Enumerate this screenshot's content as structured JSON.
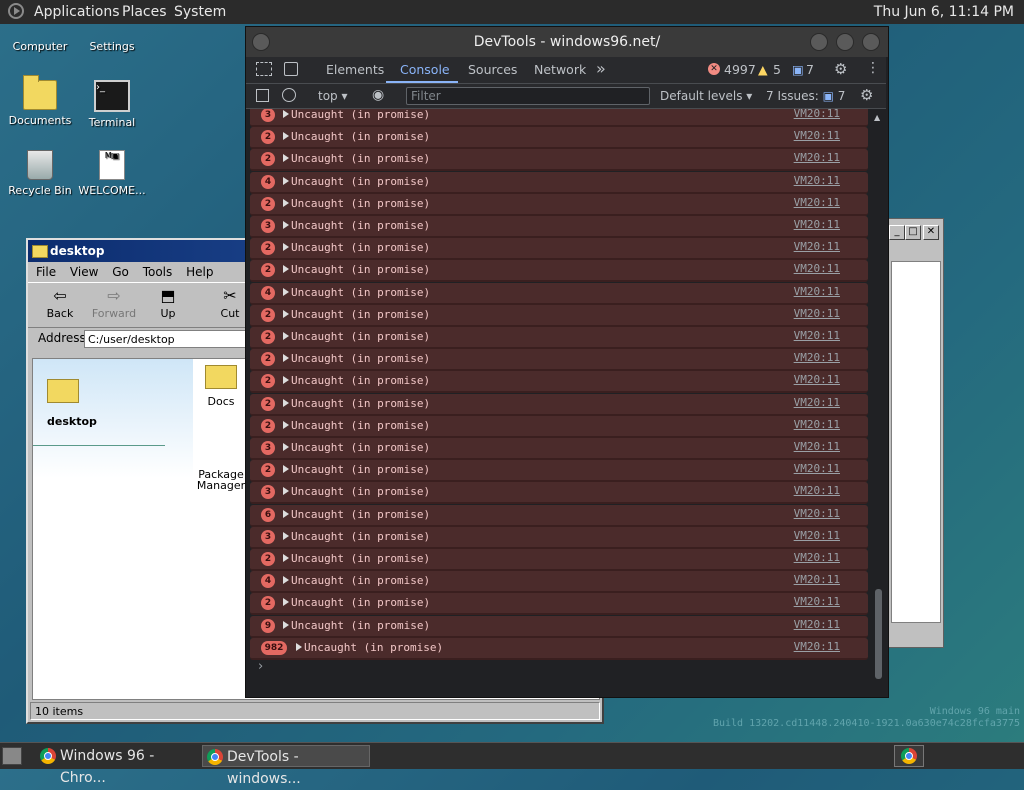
{
  "top_panel": {
    "applications": "Applications",
    "places": "Places",
    "system": "System",
    "clock": "Thu Jun  6, 11:14 PM"
  },
  "desktop_icons": [
    {
      "label": "Computer"
    },
    {
      "label": "Settings"
    },
    {
      "label": "Documents"
    },
    {
      "label": "Terminal"
    },
    {
      "label": "Recycle Bin"
    },
    {
      "label": "WELCOME..."
    }
  ],
  "explorer": {
    "title": "desktop",
    "menu": [
      "File",
      "View",
      "Go",
      "Tools",
      "Help"
    ],
    "toolbar": [
      {
        "label": "Back",
        "glyph": "⇦"
      },
      {
        "label": "Forward",
        "glyph": "⇨"
      },
      {
        "label": "Up",
        "glyph": "⬒"
      },
      {
        "label": "Cut",
        "glyph": "✂"
      }
    ],
    "address_label": "Address",
    "address_value": "C:/user/desktop",
    "sidepane_title": "desktop",
    "items": [
      {
        "label": "Docs"
      },
      {
        "label": "Package Manager"
      }
    ],
    "status": "10 items"
  },
  "devtools": {
    "title": "DevTools - windows96.net/",
    "tabs": [
      "Elements",
      "Console",
      "Sources",
      "Network"
    ],
    "more_tabs": "»",
    "error_count": "4997",
    "warning_count": "5",
    "info_count": "7",
    "context": "top",
    "filter_placeholder": "Filter",
    "levels": "Default levels",
    "issues_label": "7 Issues:",
    "issues_count": "7",
    "message": "Uncaught (in promise)",
    "source": "VM20:11",
    "badges": [
      "3",
      "2",
      "2",
      "4",
      "2",
      "3",
      "2",
      "2",
      "4",
      "2",
      "2",
      "2",
      "2",
      "2",
      "2",
      "3",
      "2",
      "3",
      "6",
      "3",
      "2",
      "4",
      "2",
      "9",
      "982"
    ],
    "prompt": "›"
  },
  "taskbar": {
    "tasks": [
      {
        "label": "Windows 96 - Chro..."
      },
      {
        "label": "DevTools - windows..."
      }
    ]
  },
  "watermark": {
    "line1": "Windows 96 main",
    "line2": "Build 13202.cd11448.240410-1921.0a630e74c28fcfa3775"
  },
  "colors": {
    "error_badge": "#e46962",
    "row_bg": "#4b2b2b",
    "accent": "#8ab4f8"
  }
}
